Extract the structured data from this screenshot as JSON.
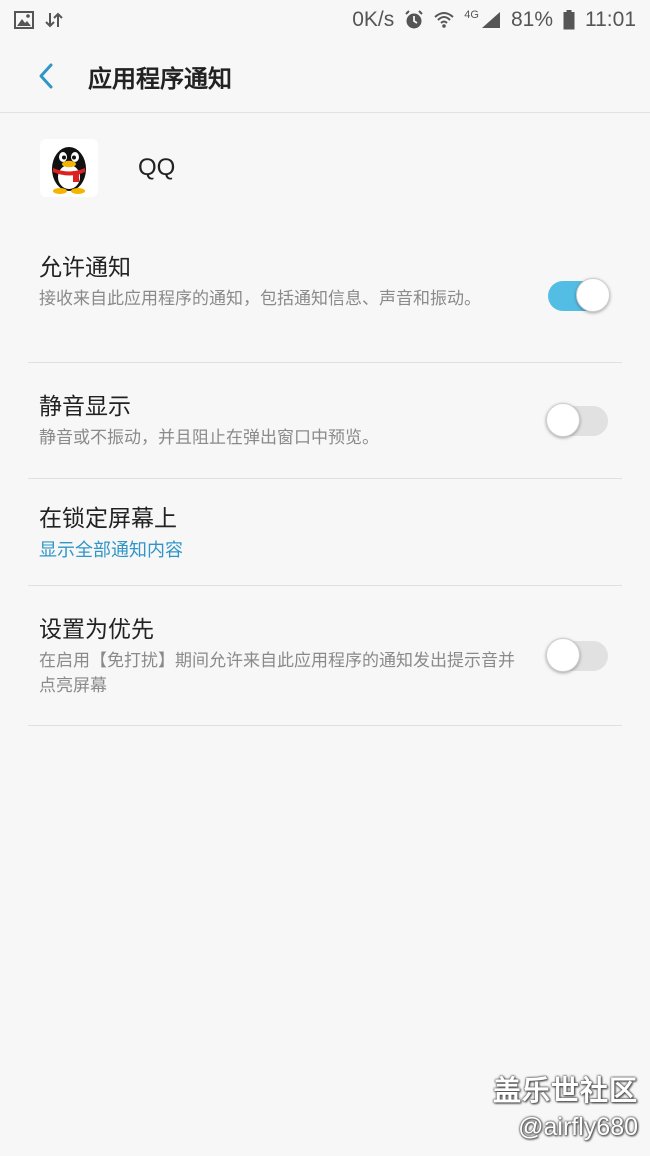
{
  "status_bar": {
    "speed": "0K/s",
    "network": "4G",
    "battery": "81%",
    "time": "11:01",
    "icons": [
      "image-icon",
      "data-transfer-icon",
      "alarm-icon",
      "wifi-icon",
      "signal-icon",
      "battery-icon"
    ]
  },
  "header": {
    "title": "应用程序通知",
    "back_icon": "back-arrow-icon"
  },
  "app": {
    "name": "QQ",
    "icon": "qq-penguin-icon"
  },
  "settings": [
    {
      "title": "允许通知",
      "description": "接收来自此应用程序的通知，包括通知信息、声音和振动。",
      "toggle": true
    },
    {
      "title": "静音显示",
      "description": "静音或不振动，并且阻止在弹出窗口中预览。",
      "toggle": false
    },
    {
      "title": "在锁定屏幕上",
      "description": "显示全部通知内容"
    },
    {
      "title": "设置为优先",
      "description": "在启用【免打扰】期间允许来自此应用程序的通知发出提示音并点亮屏幕",
      "toggle": false
    }
  ],
  "watermark": {
    "main": "盖乐世社区",
    "sub": "@airfly680"
  },
  "colors": {
    "accent": "#54bde4",
    "link": "#2f96c7",
    "background": "#f7f7f7"
  }
}
